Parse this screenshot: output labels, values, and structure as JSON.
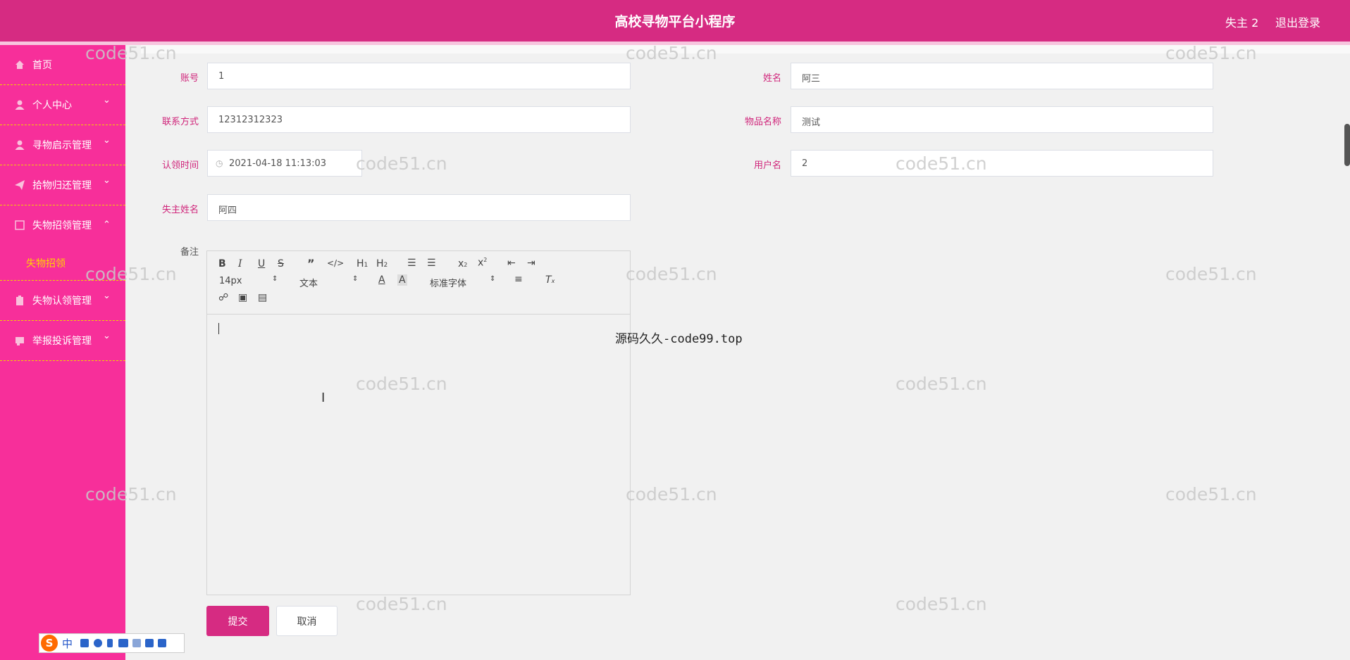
{
  "header": {
    "title": "高校寻物平台小程序",
    "user": "失主 2",
    "logout": "退出登录"
  },
  "sidebar": {
    "items": [
      {
        "label": "首页",
        "icon": "home-icon"
      },
      {
        "label": "个人中心",
        "icon": "user-icon"
      },
      {
        "label": "寻物启示管理",
        "icon": "user-icon"
      },
      {
        "label": "拾物归还管理",
        "icon": "send-icon"
      },
      {
        "label": "失物招领管理",
        "icon": "square-icon"
      },
      {
        "label": "失物认领管理",
        "icon": "clipboard-icon"
      },
      {
        "label": "举报投诉管理",
        "icon": "message-icon"
      }
    ],
    "sub_item": "失物招领"
  },
  "form": {
    "account_label": "账号",
    "account_value": "1",
    "name_label": "姓名",
    "name_value": "阿三",
    "phone_label": "联系方式",
    "phone_value": "12312312323",
    "item_label": "物品名称",
    "item_value": "测试",
    "time_label": "认领时间",
    "time_value": "2021-04-18 11:13:03",
    "username_label": "用户名",
    "username_value": "2",
    "owner_label": "失主姓名",
    "owner_value": "阿四",
    "remark_label": "备注"
  },
  "editor": {
    "font_size": "14px",
    "text_type": "文本",
    "font_family": "标准字体"
  },
  "buttons": {
    "submit": "提交",
    "cancel": "取消"
  },
  "watermark": "code51.cn",
  "source_text": "源码久久-code99.top",
  "ime": {
    "lang": "中"
  },
  "colors": {
    "accent": "#d62b82",
    "sidebar": "#f72f9a",
    "submenu_active": "#ffd400"
  }
}
